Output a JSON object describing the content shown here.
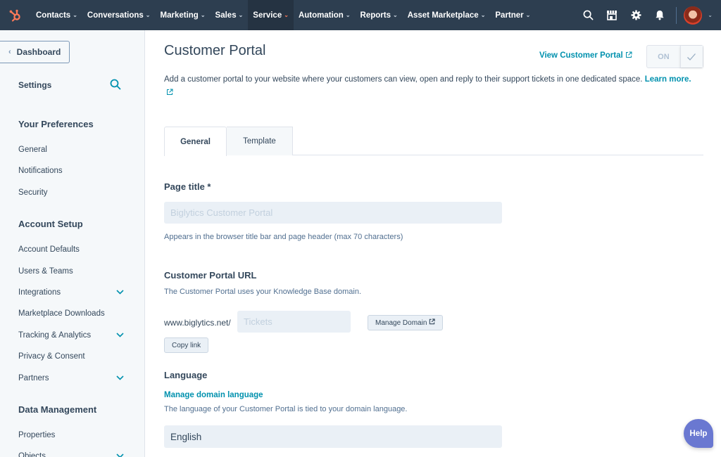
{
  "topnav": {
    "items": [
      {
        "label": "Contacts"
      },
      {
        "label": "Conversations"
      },
      {
        "label": "Marketing"
      },
      {
        "label": "Sales"
      },
      {
        "label": "Service",
        "active": true
      },
      {
        "label": "Automation"
      },
      {
        "label": "Reports"
      },
      {
        "label": "Asset Marketplace"
      },
      {
        "label": "Partner"
      }
    ],
    "icons": [
      "search-icon",
      "marketplace-icon",
      "settings-gear-icon",
      "notifications-bell-icon"
    ],
    "brand_color": "#ff7a59"
  },
  "sidebar": {
    "dashboard_label": "Dashboard",
    "settings_label": "Settings",
    "sections": [
      {
        "title": "Your Preferences",
        "items": [
          {
            "label": "General",
            "expandable": false
          },
          {
            "label": "Notifications",
            "expandable": false
          },
          {
            "label": "Security",
            "expandable": false
          }
        ]
      },
      {
        "title": "Account Setup",
        "items": [
          {
            "label": "Account Defaults",
            "expandable": false
          },
          {
            "label": "Users & Teams",
            "expandable": false
          },
          {
            "label": "Integrations",
            "expandable": true
          },
          {
            "label": "Marketplace Downloads",
            "expandable": false
          },
          {
            "label": "Tracking & Analytics",
            "expandable": true
          },
          {
            "label": "Privacy & Consent",
            "expandable": false
          },
          {
            "label": "Partners",
            "expandable": true
          }
        ]
      },
      {
        "title": "Data Management",
        "items": [
          {
            "label": "Properties",
            "expandable": false
          },
          {
            "label": "Objects",
            "expandable": true
          }
        ]
      }
    ]
  },
  "main": {
    "title": "Customer Portal",
    "view_link": "View Customer Portal",
    "toggle": {
      "state_label": "ON",
      "enabled": true
    },
    "description": "Add a customer portal to your website where your customers can view, open and reply to their support tickets in one dedicated space.",
    "learn_more": "Learn more.",
    "tabs": [
      {
        "label": "General",
        "active": true
      },
      {
        "label": "Template",
        "active": false
      }
    ],
    "page_title": {
      "label": "Page title *",
      "value": "Biglytics Customer Portal",
      "help": "Appears in the browser title bar and page header (max 70 characters)"
    },
    "portal_url": {
      "label": "Customer Portal URL",
      "help": "The Customer Portal uses your Knowledge Base domain.",
      "prefix": "www.biglytics.net/",
      "path_value": "Tickets",
      "manage_domain_label": "Manage Domain",
      "copy_link_label": "Copy link"
    },
    "language": {
      "label": "Language",
      "manage_link": "Manage domain language",
      "help": "The language of your Customer Portal is tied to your domain language.",
      "value": "English"
    }
  },
  "help_button": "Help"
}
